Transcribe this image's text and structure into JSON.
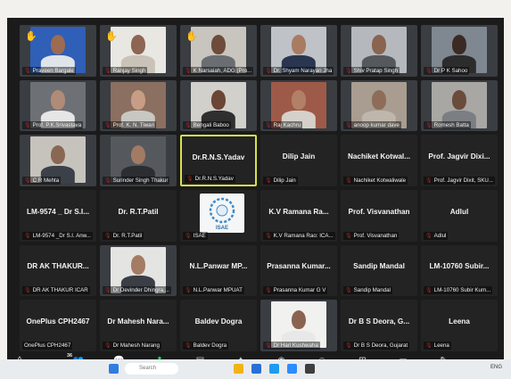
{
  "tiles": [
    {
      "label": "Praveen Bargale",
      "kind": "video",
      "hand": true,
      "photo": {
        "bg": "#2f5fb7",
        "skin": "#9c6b52",
        "shirt": "#dfe4ea"
      }
    },
    {
      "label": "Ranjay Singh",
      "kind": "video",
      "hand": true,
      "photo": {
        "bg": "#e9e7e2",
        "skin": "#8d6552",
        "shirt": "#c9c2b8"
      }
    },
    {
      "label": "K Narsaiah, ADG (Pro...",
      "kind": "video",
      "hand": true,
      "photo": {
        "bg": "#c8c5be",
        "skin": "#6e4b3a",
        "shirt": "#6a6d72"
      }
    },
    {
      "label": "Dr. Shyam Narayan Jha",
      "kind": "video",
      "hand": false,
      "photo": {
        "bg": "#bfc2c7",
        "skin": "#a97b61",
        "shirt": "#2a3550"
      }
    },
    {
      "label": "Shiv Pratap Singh",
      "kind": "video",
      "hand": false,
      "photo": {
        "bg": "#b5b9bd",
        "skin": "#8a6450",
        "shirt": "#55595e"
      }
    },
    {
      "label": "Dr P K Sahoo",
      "kind": "video",
      "hand": false,
      "photo": {
        "bg": "#7f8790",
        "skin": "#3b2a24",
        "shirt": "#2c2c2c"
      }
    },
    {
      "label": "Prof. P.K.Srivastava",
      "kind": "video",
      "hand": false,
      "photo": {
        "bg": "#6d7176",
        "skin": "#b08c78",
        "shirt": "#e6e6e6"
      }
    },
    {
      "label": "Prof. K. N. Tiwari",
      "kind": "video",
      "hand": false,
      "photo": {
        "bg": "#8b6f60",
        "skin": "#c79d85",
        "shirt": "#c9c7c2"
      }
    },
    {
      "label": "Bengali Baboo",
      "kind": "video",
      "hand": false,
      "photo": {
        "bg": "#d2d0ca",
        "skin": "#6b4536",
        "shirt": "#2f2f2f"
      }
    },
    {
      "label": "Raj Kachru",
      "kind": "video",
      "hand": false,
      "photo": {
        "bg": "#9e5a48",
        "skin": "#b28067",
        "shirt": "#d5d1ca"
      }
    },
    {
      "label": "anoop kumar dave",
      "kind": "video",
      "hand": false,
      "photo": {
        "bg": "#a89d90",
        "skin": "#8e6d58",
        "shirt": "#bfb7ab"
      }
    },
    {
      "label": "Romesh Batta",
      "kind": "video",
      "hand": false,
      "photo": {
        "bg": "#a8a7a4",
        "skin": "#6b4c3b",
        "shirt": "#7b7e83"
      }
    },
    {
      "label": "C R Mehta",
      "kind": "video",
      "hand": false,
      "photo": {
        "bg": "#c6c3bd",
        "skin": "#8a6753",
        "shirt": "#3c4048"
      }
    },
    {
      "label": "Surinder Singh Thakur",
      "kind": "video",
      "hand": false,
      "photo": {
        "bg": "#55595e",
        "skin": "#a37b63",
        "shirt": "#2b2d31"
      }
    },
    {
      "label": "Dr.R.N.S.Yadav",
      "kind": "name",
      "big": "Dr.R.N.S.Yadav",
      "active": true
    },
    {
      "label": "Dilip Jain",
      "kind": "name",
      "big": "Dilip Jain"
    },
    {
      "label": "Nachiket Kotwaliwale",
      "kind": "name",
      "big": "Nachiket Kotwal..."
    },
    {
      "label": "Prof. Jagvir Dixit, SKU...",
      "kind": "name",
      "big": "Prof. Jagvir Dixi..."
    },
    {
      "label": "LM-9574 _Dr S.I. Anw...",
      "kind": "name",
      "big": "LM-9574 _ Dr S.I..."
    },
    {
      "label": "Dr. R.T.Patil",
      "kind": "name",
      "big": "Dr. R.T.Patil"
    },
    {
      "label": "ISAE",
      "kind": "logo",
      "logo_text": "ISAE"
    },
    {
      "label": "K.V Ramana Rao: ICA...",
      "kind": "name",
      "big": "K.V Ramana Ra..."
    },
    {
      "label": "Prof. Visvanathan",
      "kind": "name",
      "big": "Prof. Visvanathan"
    },
    {
      "label": "Adlul",
      "kind": "name",
      "big": "Adlul"
    },
    {
      "label": "DR AK THAKUR ICAR",
      "kind": "name",
      "big": "DR AK THAKUR..."
    },
    {
      "label": "Dr Devinder Dhingra,...",
      "kind": "video",
      "hand": false,
      "photo": {
        "bg": "#e4e4e2",
        "skin": "#a47c64",
        "shirt": "#3b3e44"
      }
    },
    {
      "label": "N.L.Panwar MPUAT",
      "kind": "name",
      "big": "N.L.Panwar MP..."
    },
    {
      "label": "Prasanna Kumar G V",
      "kind": "name",
      "big": "Prasanna Kumar..."
    },
    {
      "label": "Sandip Mandal",
      "kind": "name",
      "big": "Sandip Mandal"
    },
    {
      "label": "LM-10760 Subir Kum...",
      "kind": "name",
      "big": "LM-10760 Subir..."
    },
    {
      "label": "OnePlus CPH2467",
      "kind": "name",
      "big": "OnePlus CPH2467",
      "nomic": true
    },
    {
      "label": "Dr Mahesh Narang",
      "kind": "name",
      "big": "Dr Mahesh Nara..."
    },
    {
      "label": "Baldev Dogra",
      "kind": "name",
      "big": "Baldev Dogra"
    },
    {
      "label": "Dr Hari Kushwaha",
      "kind": "video",
      "hand": false,
      "photo": {
        "bg": "#f1f1ef",
        "skin": "#8a6451",
        "shirt": "#e8e8e8"
      }
    },
    {
      "label": "Dr B S Deora, Gujarat",
      "kind": "name",
      "big": "Dr B S Deora, G..."
    },
    {
      "label": "Leena",
      "kind": "name",
      "big": "Leena"
    }
  ],
  "toolbar": {
    "audio_label": "eo",
    "participants_count": "36",
    "items": [
      {
        "name": "participants",
        "label": "Participants",
        "icon": "👥"
      },
      {
        "name": "chat",
        "label": "Chat",
        "icon": "💬"
      },
      {
        "name": "share-screen",
        "label": "Share Screen",
        "icon": "⬆",
        "green": true
      },
      {
        "name": "summary",
        "label": "Summary",
        "icon": "▤"
      },
      {
        "name": "ai-companion",
        "label": "AI Companion",
        "icon": "✦"
      },
      {
        "name": "record",
        "label": "Record",
        "icon": "◉"
      },
      {
        "name": "reactions",
        "label": "Reactions",
        "icon": "☺"
      },
      {
        "name": "apps",
        "label": "Apps",
        "icon": "⊞"
      },
      {
        "name": "whiteboards",
        "label": "Whiteboards",
        "icon": "▭"
      },
      {
        "name": "notes",
        "label": "Notes",
        "icon": "✎"
      },
      {
        "name": "more",
        "label": "More",
        "icon": "⋯"
      }
    ]
  },
  "taskbar": {
    "search_placeholder": "Search",
    "tray_text": "ENG"
  },
  "colors": {
    "mute_red": "#e4372e",
    "active_border": "#d8e24a",
    "share_green": "#1fcf5a",
    "hand_yellow": "#f6b400"
  }
}
